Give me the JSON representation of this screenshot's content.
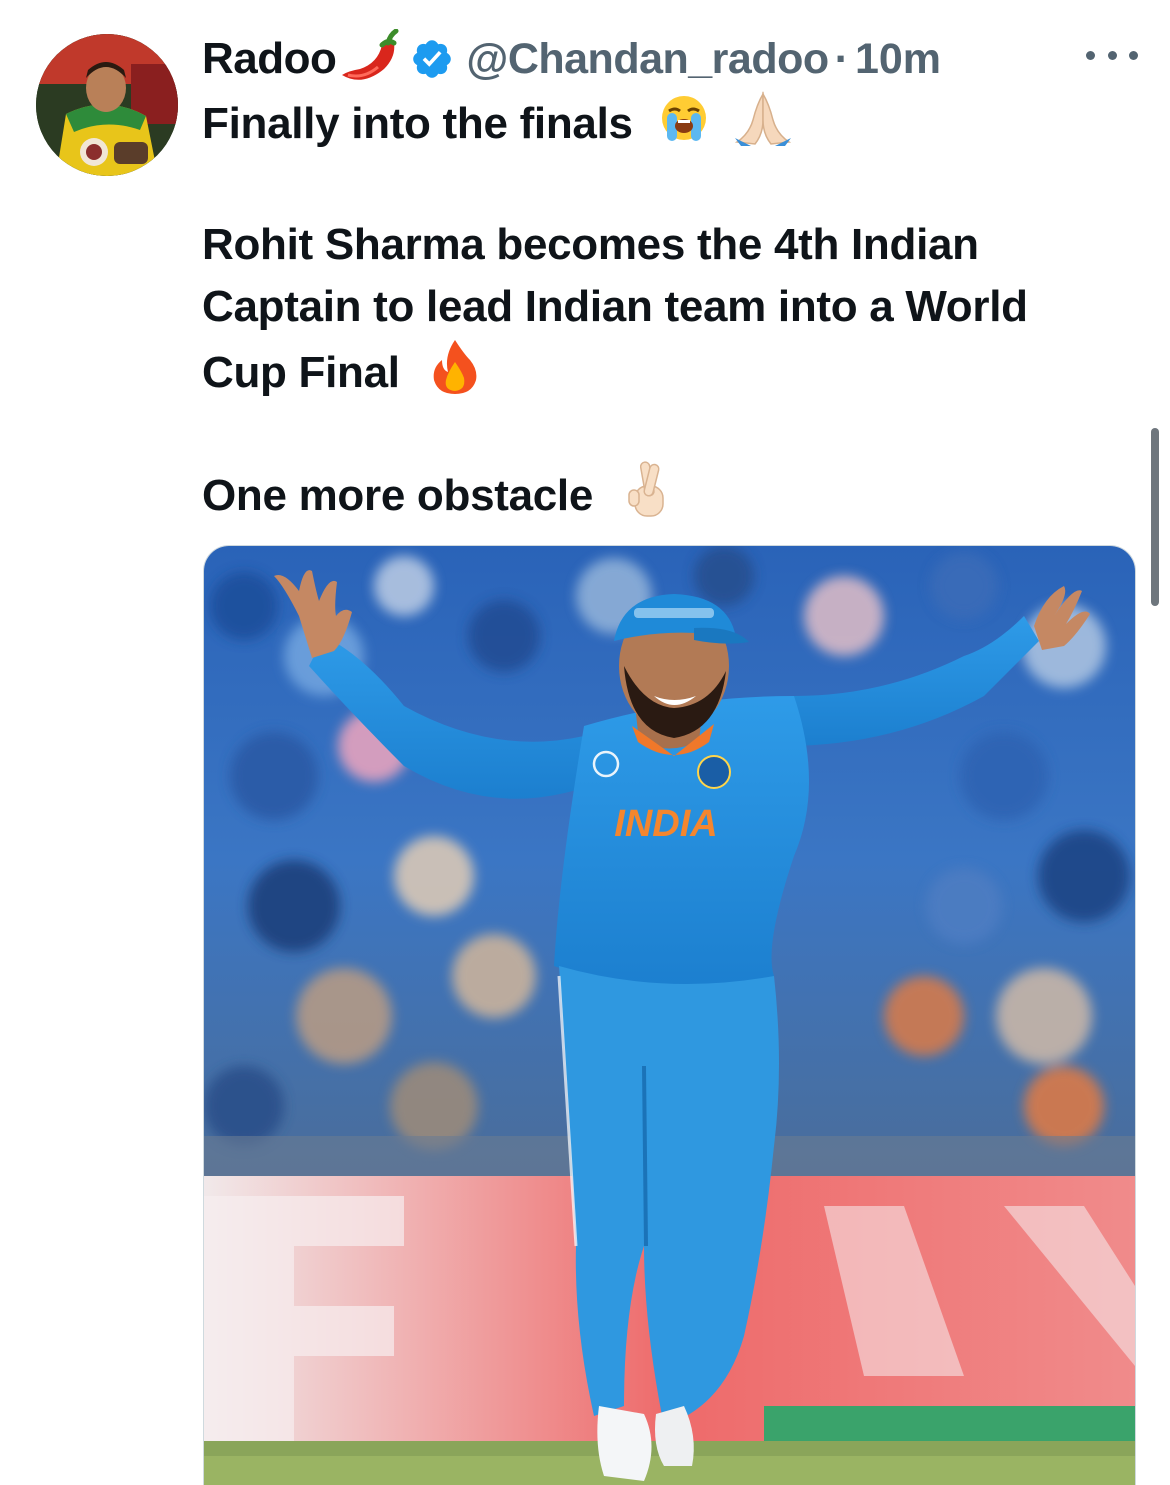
{
  "tweet": {
    "author_name": "Radoo",
    "handle": "@Chandan_radoo",
    "separator": "·",
    "time": "10m",
    "line1": "Finally into the finals",
    "para2_line1": "Rohit Sharma becomes the 4th Indian",
    "para2_line2": "Captain to lead Indian team into a World",
    "para2_line3": "Cup Final",
    "line3": "One more obstacle",
    "jersey_text": "INDIA"
  },
  "icons": {
    "chili": "chili-pepper-emoji",
    "verified": "verified-badge-icon",
    "more": "more-options-icon",
    "crying": "loudly-crying-face-emoji",
    "pray": "folded-hands-emoji",
    "fire": "fire-emoji",
    "crossed": "crossed-fingers-emoji"
  },
  "colors": {
    "text_primary": "#0f1419",
    "text_secondary": "#536471",
    "verified_blue": "#1d9bf0",
    "jersey_blue": "#1e88d8"
  }
}
